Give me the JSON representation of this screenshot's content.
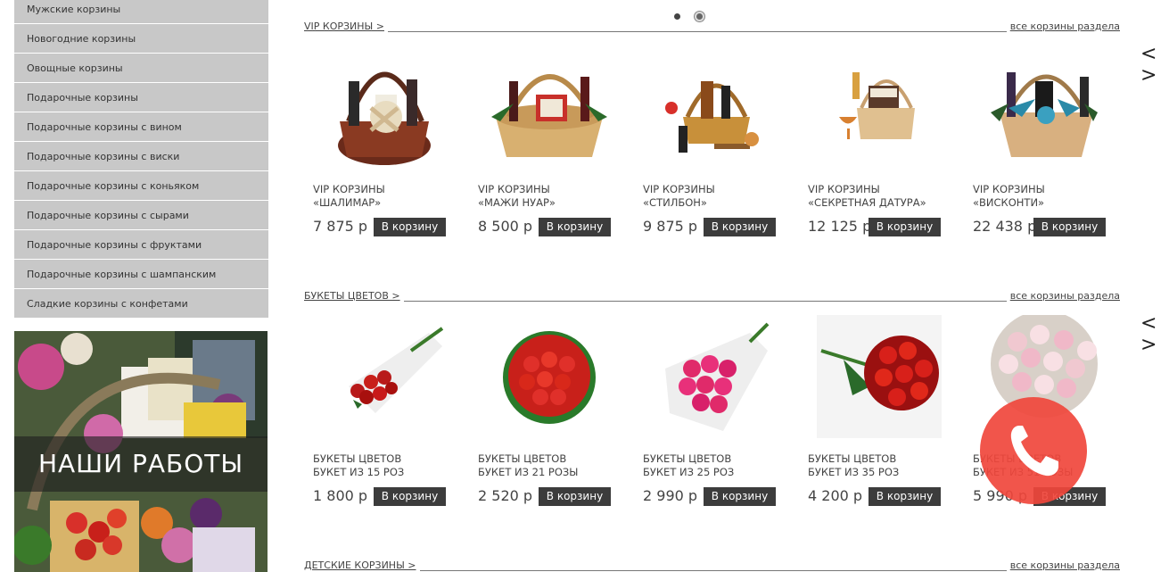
{
  "sidebar": {
    "items": [
      {
        "label": "Мужские корзины"
      },
      {
        "label": "Новогодние корзины"
      },
      {
        "label": "Овощные корзины"
      },
      {
        "label": "Подарочные корзины"
      },
      {
        "label": "Подарочные корзины с вином"
      },
      {
        "label": "Подарочные корзины с виски"
      },
      {
        "label": "Подарочные корзины с коньяком"
      },
      {
        "label": "Подарочные корзины с сырами"
      },
      {
        "label": "Подарочные корзины с фруктами"
      },
      {
        "label": "Подарочные корзины с шампанским"
      },
      {
        "label": "Сладкие корзины с конфетами"
      }
    ],
    "works_banner": "НАШИ РАБОТЫ"
  },
  "sections": [
    {
      "title": "VIP КОРЗИНЫ >",
      "all_link": "все корзины раздела",
      "prev_icon": "<",
      "next_icon": ">",
      "products": [
        {
          "name1": "VIP КОРЗИНЫ",
          "name2": "«ШАЛИМАР»",
          "price": "7 875 р",
          "button": "В корзину",
          "image": "basket-image"
        },
        {
          "name1": "VIP КОРЗИНЫ",
          "name2": "«МАЖИ НУАР»",
          "price": "8 500 р",
          "button": "В корзину",
          "image": "basket-image"
        },
        {
          "name1": "VIP КОРЗИНЫ",
          "name2": "«СТИЛБОН»",
          "price": "9 875 р",
          "button": "В корзину",
          "image": "basket-image"
        },
        {
          "name1": "VIP КОРЗИНЫ",
          "name2": "«СЕКРЕТНАЯ ДАТУРА»",
          "price": "12 125 р",
          "button": "В корзину",
          "image": "basket-image"
        },
        {
          "name1": "VIP КОРЗИНЫ",
          "name2": "«ВИСКОНТИ»",
          "price": "22 438 р",
          "button": "В корзину",
          "image": "basket-image"
        }
      ]
    },
    {
      "title": "БУКЕТЫ ЦВЕТОВ >",
      "all_link": "все корзины раздела",
      "prev_icon": "<",
      "next_icon": ">",
      "products": [
        {
          "name1": "БУКЕТЫ ЦВЕТОВ",
          "name2": "БУКЕТ ИЗ 15 РОЗ",
          "price": "1 800 р",
          "button": "В корзину",
          "image": "bouquet-image"
        },
        {
          "name1": "БУКЕТЫ ЦВЕТОВ",
          "name2": "БУКЕТ ИЗ 21 РОЗЫ",
          "price": "2 520 р",
          "button": "В корзину",
          "image": "bouquet-image"
        },
        {
          "name1": "БУКЕТЫ ЦВЕТОВ",
          "name2": "БУКЕТ ИЗ 25 РОЗ",
          "price": "2 990 р",
          "button": "В корзину",
          "image": "bouquet-image"
        },
        {
          "name1": "БУКЕТЫ ЦВЕТОВ",
          "name2": "БУКЕТ ИЗ 35 РОЗ",
          "price": "4 200 р",
          "button": "В корзину",
          "image": "bouquet-image"
        },
        {
          "name1": "БУКЕТЫ ЦВЕТОВ",
          "name2": "БУКЕТ ИЗ 51 РОЗЫ",
          "price": "5 990 р",
          "button": "В корзину",
          "image": "bouquet-image"
        }
      ]
    },
    {
      "title": "ДЕТСКИЕ КОРЗИНЫ >",
      "all_link": "все корзины раздела"
    }
  ],
  "colors": {
    "sidebar_bg": "#c8c8c8",
    "button_bg": "#3c3c3c",
    "phone_bg": "#f0463c"
  },
  "icons": {
    "phone": "phone-icon",
    "slider_dot": "slider-dot-icon"
  }
}
